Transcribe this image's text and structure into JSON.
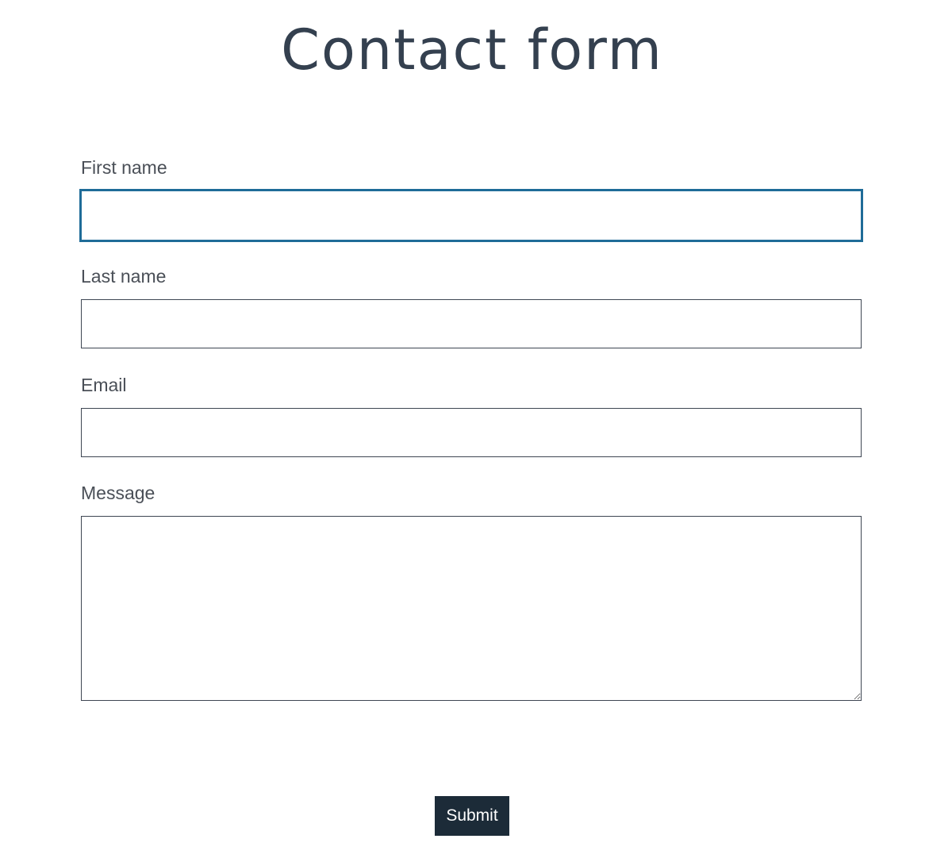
{
  "page": {
    "title": "Contact form"
  },
  "form": {
    "fields": [
      {
        "label": "First name",
        "value": "",
        "placeholder": "",
        "type": "text",
        "focused": true
      },
      {
        "label": "Last name",
        "value": "",
        "placeholder": "",
        "type": "text",
        "focused": false
      },
      {
        "label": "Email",
        "value": "",
        "placeholder": "",
        "type": "email",
        "focused": false
      },
      {
        "label": "Message",
        "value": "",
        "placeholder": "",
        "type": "textarea",
        "focused": false
      }
    ],
    "submit_label": "Submit"
  },
  "colors": {
    "title": "#34404f",
    "focus_border": "#1f6c98",
    "field_border": "#3e4653",
    "button_bg": "#1c2b38",
    "button_text": "#ffffff"
  }
}
